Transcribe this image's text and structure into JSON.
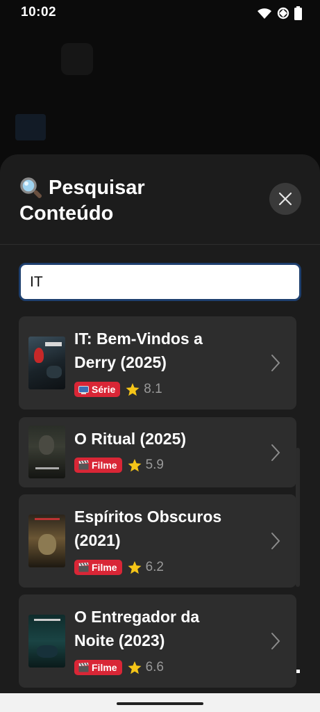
{
  "status_bar": {
    "time": "10:02"
  },
  "sheet": {
    "title_line1": "Pesquisar",
    "title_line2": "Conteúdo",
    "title_icon": "search-icon",
    "close_icon": "close-icon"
  },
  "search": {
    "value": "IT",
    "placeholder": ""
  },
  "results": [
    {
      "title_line1": "IT: Bem-Vindos a",
      "title_line2": "Derry (2025)",
      "type_label": "Série",
      "type_icon": "tv-icon",
      "rating": "8.1"
    },
    {
      "title_line1": "O Ritual (2025)",
      "title_line2": "",
      "type_label": "Filme",
      "type_icon": "clapperboard-icon",
      "rating": "5.9"
    },
    {
      "title_line1": "Espíritos Obscuros",
      "title_line2": "(2021)",
      "type_label": "Filme",
      "type_icon": "clapperboard-icon",
      "rating": "6.2"
    },
    {
      "title_line1": "O Entregador da",
      "title_line2": "Noite (2023)",
      "type_label": "Filme",
      "type_icon": "clapperboard-icon",
      "rating": "6.6"
    }
  ],
  "colors": {
    "sheet_bg": "#1c1c1c",
    "card_bg": "#2d2d2d",
    "badge_red": "#d92636",
    "star_yellow": "#f5c518",
    "input_border": "#1e3f6e"
  }
}
